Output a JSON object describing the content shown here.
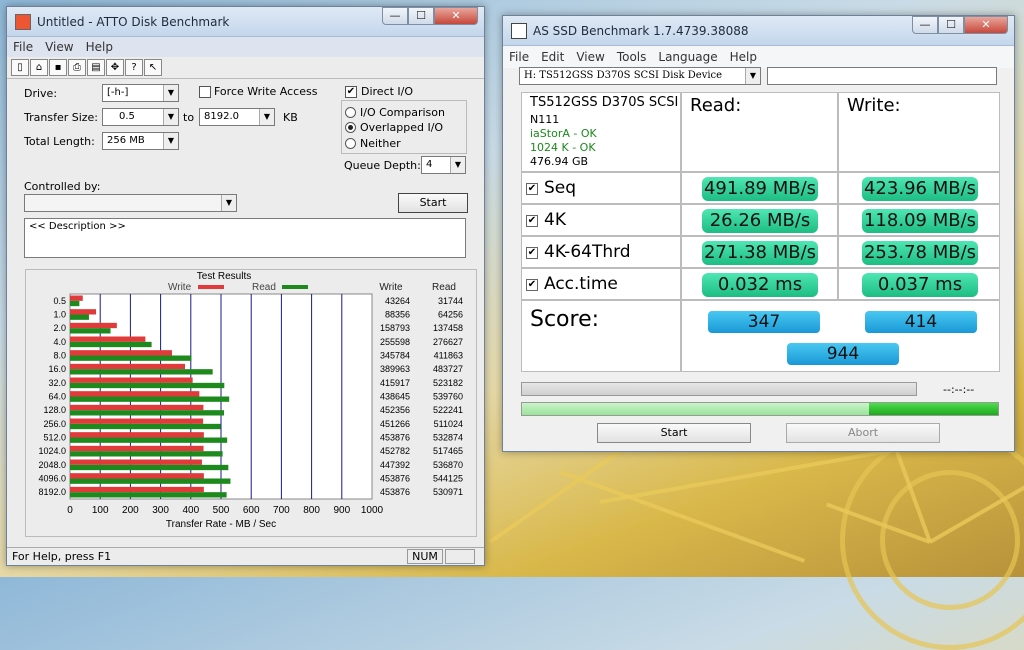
{
  "atto": {
    "title": "Untitled - ATTO Disk Benchmark",
    "menu": [
      "File",
      "View",
      "Help"
    ],
    "toolbar_icons": [
      "new-icon",
      "open-icon",
      "save-icon",
      "print-icon",
      "print-preview-icon",
      "move-icon",
      "help-icon",
      "context-help-icon"
    ],
    "drive_label": "Drive:",
    "drive_value": "[-h-]",
    "force_write_label": "Force Write Access",
    "direct_io_label": "Direct I/O",
    "transfer_size_label": "Transfer Size:",
    "transfer_from": "0.5",
    "to_label": "to",
    "transfer_to": "8192.0",
    "kb_label": "KB",
    "total_length_label": "Total Length:",
    "total_length_value": "256 MB",
    "io_comparison_label": "I/O Comparison",
    "overlapped_label": "Overlapped I/O",
    "neither_label": "Neither",
    "queue_depth_label": "Queue Depth:",
    "queue_depth_value": "4",
    "controlled_by_label": "Controlled by:",
    "start_label": "Start",
    "description": "<< Description >>",
    "status_text": "For Help, press F1",
    "status_num": "NUM",
    "window_controls": [
      "—",
      "☐",
      "✕"
    ]
  },
  "chart_data": {
    "type": "bar",
    "title": "Test Results",
    "legend": [
      "Write",
      "Read"
    ],
    "xlabel": "Transfer Rate - MB / Sec",
    "xticks": [
      "0",
      "100",
      "200",
      "300",
      "400",
      "500",
      "600",
      "700",
      "800",
      "900",
      "1000"
    ],
    "xlim": [
      0,
      1000
    ],
    "col_write": "Write",
    "col_read": "Read",
    "categories": [
      "0.5",
      "1.0",
      "2.0",
      "4.0",
      "8.0",
      "16.0",
      "32.0",
      "64.0",
      "128.0",
      "256.0",
      "512.0",
      "1024.0",
      "2048.0",
      "4096.0",
      "8192.0"
    ],
    "write": [
      43264,
      88356,
      158793,
      255598,
      345784,
      389963,
      415917,
      438645,
      452356,
      451266,
      453876,
      452782,
      447392,
      453876,
      453876
    ],
    "read": [
      31744,
      64256,
      137458,
      276627,
      411863,
      483727,
      523182,
      539760,
      522241,
      511024,
      532874,
      517465,
      536870,
      544125,
      530971
    ],
    "write_color": "#e03a3a",
    "read_color": "#1e8a1e"
  },
  "asssd": {
    "title": "AS SSD Benchmark 1.7.4739.38088",
    "menu": [
      "File",
      "Edit",
      "View",
      "Tools",
      "Language",
      "Help"
    ],
    "drive_select": "H: TS512GSS D370S SCSI Disk Device",
    "device_name": "TS512GSS D370S SCSI",
    "firmware": "N111",
    "driver_status": "iaStorA - OK",
    "align_status": "1024 K - OK",
    "capacity": "476.94 GB",
    "read_header": "Read:",
    "write_header": "Write:",
    "rows": [
      {
        "label": "Seq",
        "read": "491.89 MB/s",
        "write": "423.96 MB/s"
      },
      {
        "label": "4K",
        "read": "26.26 MB/s",
        "write": "118.09 MB/s"
      },
      {
        "label": "4K-64Thrd",
        "read": "271.38 MB/s",
        "write": "253.78 MB/s"
      },
      {
        "label": "Acc.time",
        "read": "0.032 ms",
        "write": "0.037 ms"
      }
    ],
    "score_label": "Score:",
    "score_read": "347",
    "score_write": "414",
    "score_total": "944",
    "time_display": "--:--:--",
    "progress_2": 0.73,
    "start_label": "Start",
    "abort_label": "Abort",
    "ok_color": "#1a8a1a",
    "window_controls": [
      "—",
      "☐",
      "✕"
    ]
  }
}
